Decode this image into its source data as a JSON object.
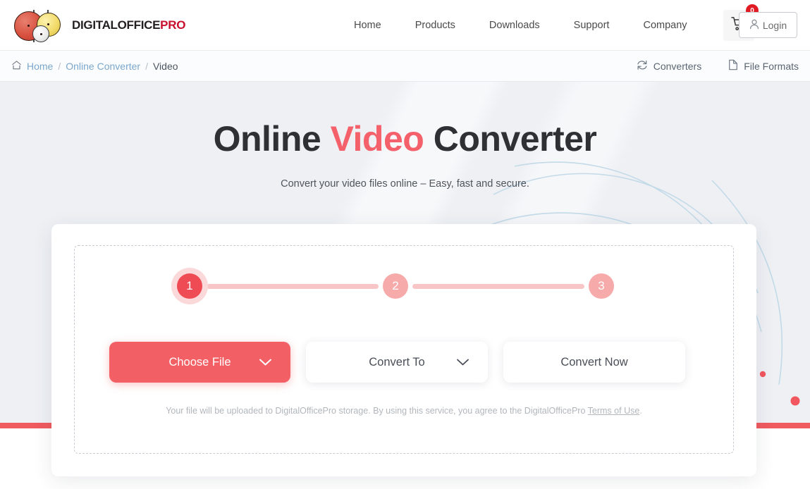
{
  "brand": {
    "name_dark": "DIGITALOFFICE",
    "name_red": "PRO",
    "logo_icon": "three-circles-logo"
  },
  "header": {
    "nav": [
      {
        "label": "Home"
      },
      {
        "label": "Products"
      },
      {
        "label": "Downloads"
      },
      {
        "label": "Support"
      },
      {
        "label": "Company"
      }
    ],
    "cart": {
      "icon": "shopping-cart-icon",
      "count": "0"
    },
    "login": {
      "label": "Login",
      "icon": "user-icon"
    }
  },
  "breadcrumb": {
    "home_icon": "home-icon",
    "items": [
      {
        "label": "Home",
        "type": "link"
      },
      {
        "label": "Online Converter",
        "type": "link"
      },
      {
        "label": "Video",
        "type": "current"
      }
    ],
    "separator": "/",
    "actions": [
      {
        "label": "Converters",
        "icon": "refresh-icon"
      },
      {
        "label": "File Formats",
        "icon": "document-icon"
      }
    ]
  },
  "hero": {
    "title_before": "Online ",
    "title_accent": "Video",
    "title_after": " Converter",
    "subtitle": "Convert your video files online – Easy, fast and secure."
  },
  "converter": {
    "steps": [
      {
        "number": "1",
        "state": "active"
      },
      {
        "number": "2",
        "state": "inactive"
      },
      {
        "number": "3",
        "state": "inactive"
      }
    ],
    "buttons": {
      "choose_file": {
        "label": "Choose File",
        "icon": "chevron-down-icon"
      },
      "convert_to": {
        "label": "Convert To",
        "icon": "chevron-down-icon"
      },
      "convert_now": {
        "label": "Convert Now"
      }
    },
    "note_text": "Your file will be uploaded to DigitalOfficePro storage.  By using this service, you agree to the DigitalOfficePro ",
    "note_link": "Terms of Use",
    "note_end": "."
  },
  "colors": {
    "accent_red": "#f4616b",
    "button_red": "#f25f64",
    "step_active": "#ef4b55",
    "step_inactive": "#f6aaaa",
    "hero_bg": "#eef0f4",
    "link_blue": "#7ba7cc",
    "badge_red": "#e01b24",
    "illu_teal": "#3aa8c6",
    "illu_navy": "#2b3a5c"
  }
}
